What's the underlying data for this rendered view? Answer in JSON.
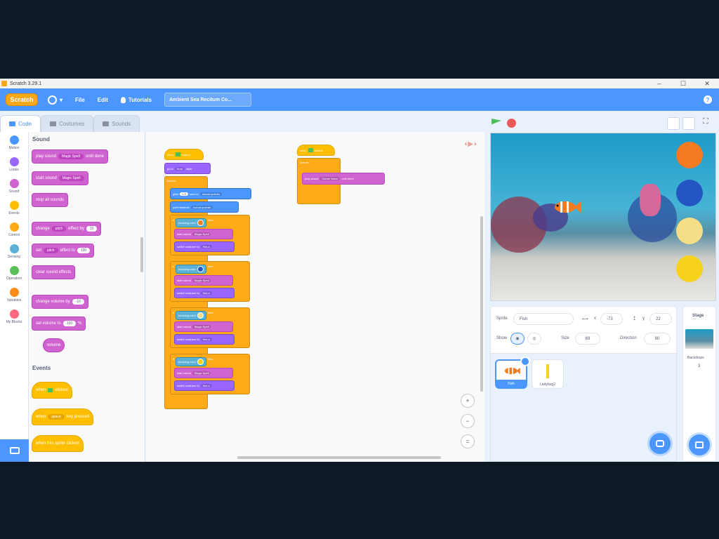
{
  "window": {
    "title": "Scratch 3.29.1",
    "controls": [
      "–",
      "☐",
      "✕"
    ]
  },
  "menubar": {
    "logo": "Scratch",
    "file": "File",
    "edit": "Edit",
    "tutorials": "Tutorials",
    "project_title": "Ambient Sea Recitum Co...",
    "help": "?"
  },
  "tabs": {
    "code": "Code",
    "costumes": "Costumes",
    "sounds": "Sounds"
  },
  "categories": [
    {
      "label": "Motion",
      "color": "#4c97ff"
    },
    {
      "label": "Looks",
      "color": "#9966ff"
    },
    {
      "label": "Sound",
      "color": "#cf63cf"
    },
    {
      "label": "Events",
      "color": "#ffbf00"
    },
    {
      "label": "Control",
      "color": "#ffab19"
    },
    {
      "label": "Sensing",
      "color": "#5cb1d6"
    },
    {
      "label": "Operators",
      "color": "#59c059"
    },
    {
      "label": "Variables",
      "color": "#ff8c1a"
    },
    {
      "label": "My Blocks",
      "color": "#ff6680"
    }
  ],
  "palette": {
    "sound_heading": "Sound",
    "play_until_done": "play sound",
    "play_until_done_drop": "Magic Spell",
    "play_until_done_suffix": "until done",
    "start_sound": "start sound",
    "start_sound_drop": "Magic Spell",
    "stop_all": "stop all sounds",
    "change_effect": "change",
    "change_effect_drop": "pitch",
    "change_effect_mid": "effect by",
    "change_effect_val": "10",
    "set_effect": "set",
    "set_effect_drop": "pitch",
    "set_effect_mid": "effect to",
    "set_effect_val": "100",
    "clear_effects": "clear sound effects",
    "change_volume": "change volume by",
    "change_volume_val": "-10",
    "set_volume": "set volume to",
    "set_volume_val": "100",
    "set_volume_unit": "%",
    "volume": "volume",
    "events_heading": "Events",
    "when_flag": "when",
    "when_flag_suffix": "clicked",
    "when_key": "when",
    "when_key_drop": "space",
    "when_key_suffix": "key pressed",
    "when_sprite": "when this sprite clicked"
  },
  "script1": {
    "hat": "when",
    "hat_suffix": "clicked",
    "goto": "go to",
    "goto_drop": "front",
    "goto_suffix": "layer",
    "forever": "forever",
    "glide": "glide",
    "glide_val": "0.5",
    "glide_mid": "secs to",
    "glide_drop": "mouse-pointer",
    "point": "point towards",
    "point_drop": "mouse-pointer",
    "if_word": "if",
    "then_word": "then",
    "touching": "touching color",
    "start_sound": "start sound",
    "sound_drop": "Magic Spell",
    "switch_costume": "switch costume to",
    "costume_drop": "fish-a",
    "if_colors": [
      "#f47b20",
      "#2455c3",
      "#f4de86",
      "#f7d21c"
    ]
  },
  "script2": {
    "hat": "when",
    "hat_suffix": "clicked",
    "forever": "forever",
    "play": "play sound",
    "play_drop": "Ocean Wave",
    "play_suffix": "until done"
  },
  "stage": {
    "ball_colors": [
      "#f47b20",
      "#2455c3",
      "#f4de86",
      "#f7d21c"
    ]
  },
  "sprite_info": {
    "sprite_label": "Sprite",
    "sprite_name": "Fish",
    "x_label": "x",
    "x_value": "-73",
    "y_label": "y",
    "y_value": "22",
    "show_label": "Show",
    "size_label": "Size",
    "size_value": "69",
    "direction_label": "Direction",
    "direction_value": "90"
  },
  "sprites": [
    {
      "name": "Fish",
      "selected": true
    },
    {
      "name": "Ladybug2",
      "selected": false
    }
  ],
  "stage_panel": {
    "title": "Stage",
    "backdrops_label": "Backdrops",
    "backdrops_count": "3"
  }
}
